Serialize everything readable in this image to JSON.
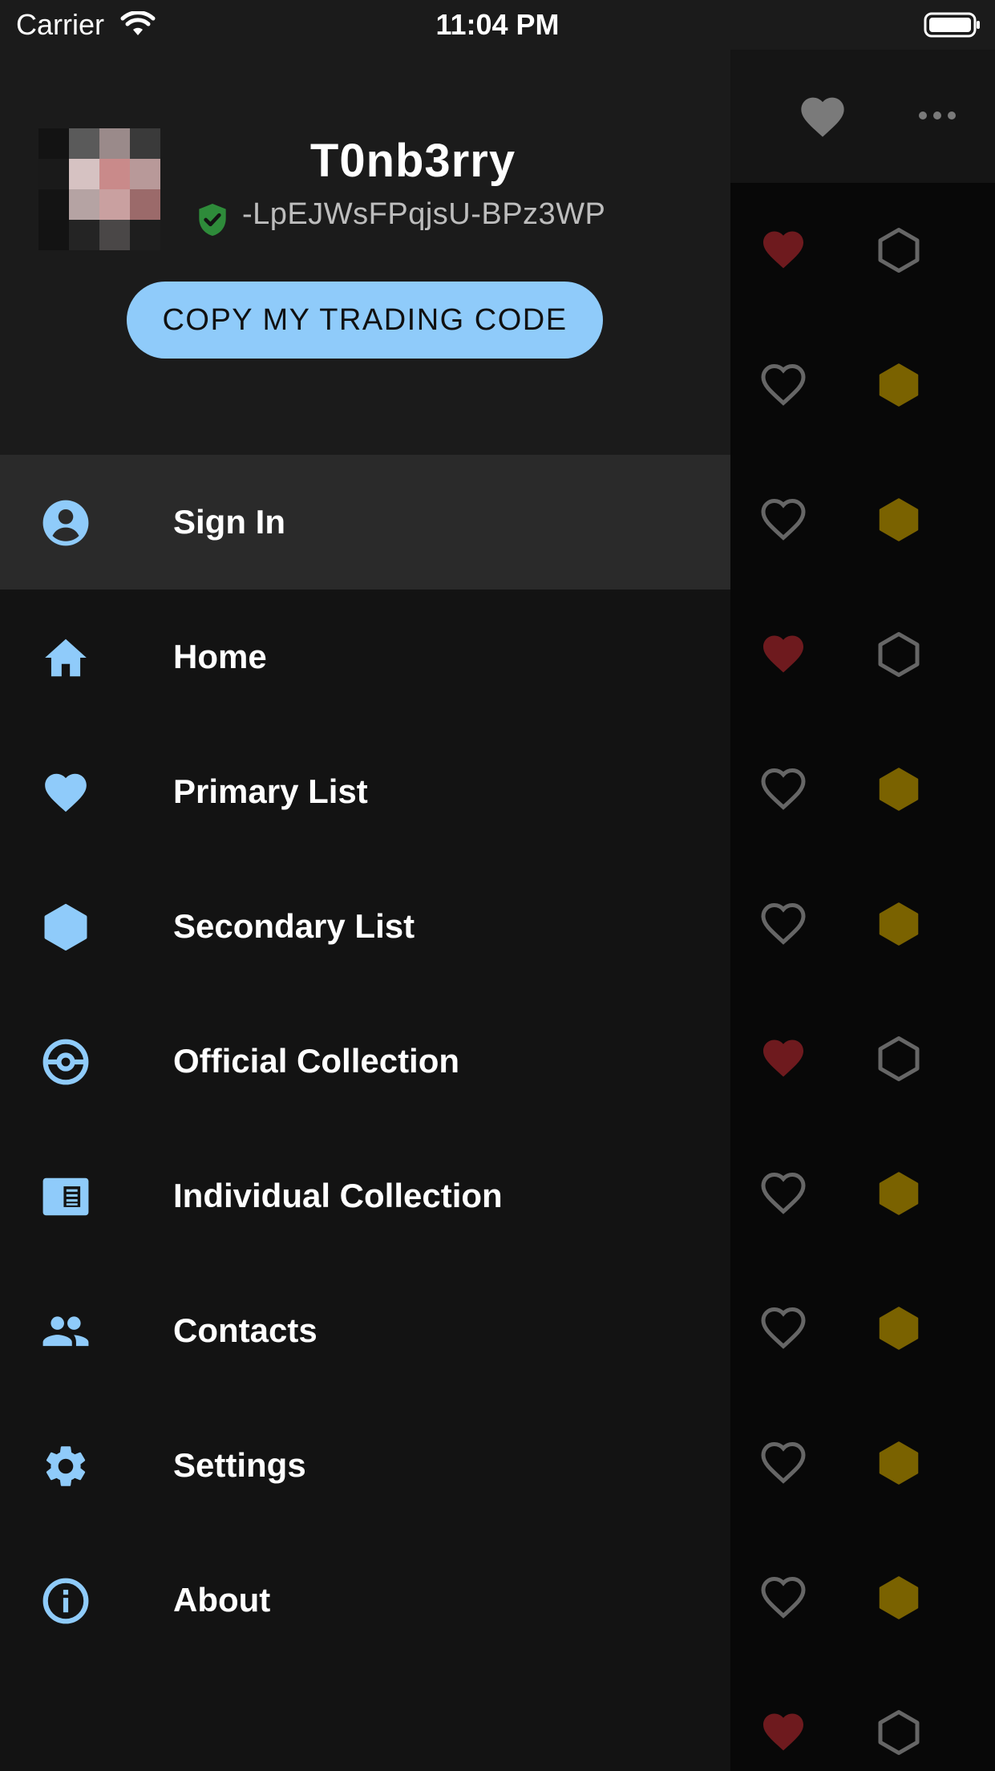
{
  "status_bar": {
    "carrier": "Carrier",
    "time": "11:04 PM"
  },
  "drawer": {
    "username": "T0nb3rry",
    "trading_code": "-LpEJWsFPqjsU-BPz3WP",
    "copy_button_label": "COPY MY TRADING CODE",
    "menu": [
      {
        "label": "Sign In",
        "icon": "account-circle-icon",
        "active": true
      },
      {
        "label": "Home",
        "icon": "home-icon"
      },
      {
        "label": "Primary List",
        "icon": "heart-icon"
      },
      {
        "label": "Secondary List",
        "icon": "hexagon-icon"
      },
      {
        "label": "Official Collection",
        "icon": "pokeball-icon"
      },
      {
        "label": "Individual Collection",
        "icon": "newspaper-icon"
      },
      {
        "label": "Contacts",
        "icon": "people-icon"
      },
      {
        "label": "Settings",
        "icon": "gear-icon"
      },
      {
        "label": "About",
        "icon": "info-icon"
      }
    ]
  },
  "background_list": {
    "header_icons": [
      "favorite-filter-icon",
      "more-horizontal-icon"
    ],
    "rows": [
      {
        "favorite": true,
        "secondary": false
      },
      {
        "favorite": false,
        "secondary": true
      },
      {
        "favorite": false,
        "secondary": true
      },
      {
        "favorite": true,
        "secondary": false
      },
      {
        "favorite": false,
        "secondary": true
      },
      {
        "favorite": false,
        "secondary": true
      },
      {
        "favorite": true,
        "secondary": false
      },
      {
        "favorite": false,
        "secondary": true
      },
      {
        "favorite": false,
        "secondary": true
      },
      {
        "favorite": false,
        "secondary": true
      },
      {
        "favorite": false,
        "secondary": true
      },
      {
        "favorite": true,
        "secondary": false
      }
    ]
  },
  "colors": {
    "accent": "#8fcbfa",
    "verified": "#2e8b3a",
    "favorite_dim": "#6e1a1e",
    "secondary_dim": "#7a6200",
    "outline_dim": "#666666"
  }
}
